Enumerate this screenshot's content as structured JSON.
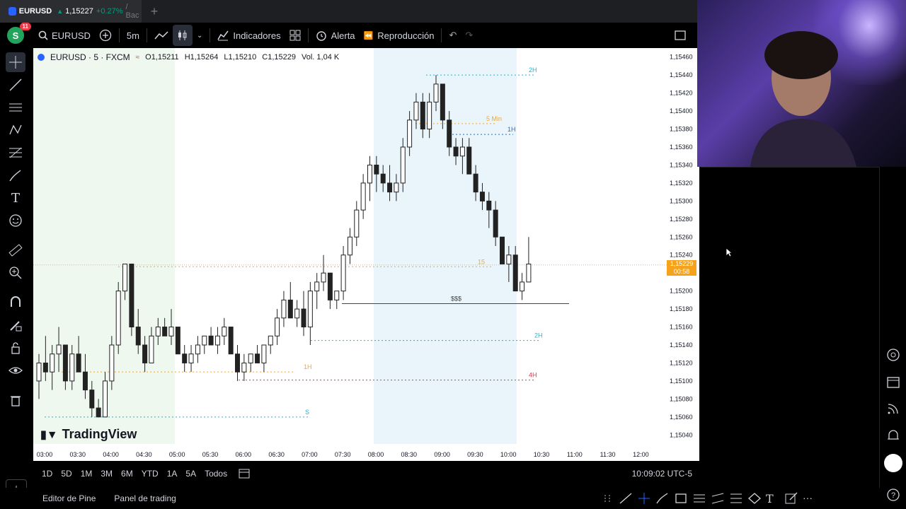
{
  "browser_tab": {
    "symbol": "EURUSD",
    "price": "1,15227",
    "change": "+0.27%",
    "suffix": "/ Bac"
  },
  "toolbar": {
    "avatar_letter": "S",
    "notifications": "11",
    "symbol": "EURUSD",
    "interval": "5m",
    "indicators_label": "Indicadores",
    "alert_label": "Alerta",
    "replay_label": "Reproducción"
  },
  "legend": {
    "title": "EURUSD · 5 · FXCM",
    "open": "O1,15211",
    "high": "H1,15264",
    "low": "L1,15210",
    "close": "C1,15229",
    "volume": "Vol. 1,04 K"
  },
  "price_tag": {
    "price": "1,15229",
    "countdown": "00:58"
  },
  "brand": "TradingView",
  "annotations": {
    "h2_top": "2H",
    "min5": "5 Min",
    "h1_top": "1H",
    "min15": "15",
    "sss": "$$$",
    "h2_mid": "2H",
    "h1_left": "1H",
    "h4": "4H",
    "s": "S"
  },
  "chart_data": {
    "type": "candlestick",
    "symbol": "EURUSD",
    "interval": "5",
    "exchange": "FXCM",
    "y_axis_ticks": [
      "1,15460",
      "1,15440",
      "1,15420",
      "1,15400",
      "1,15380",
      "1,15360",
      "1,15340",
      "1,15320",
      "1,15300",
      "1,15280",
      "1,15260",
      "1,15240",
      "1,15220",
      "1,15200",
      "1,15180",
      "1,15160",
      "1,15140",
      "1,15120",
      "1,15100",
      "1,15080",
      "1,15060",
      "1,15040"
    ],
    "x_axis_ticks": [
      "03:00",
      "03:30",
      "04:00",
      "04:30",
      "05:00",
      "05:30",
      "06:00",
      "06:30",
      "07:00",
      "07:30",
      "08:00",
      "08:30",
      "09:00",
      "09:30",
      "10:00",
      "10:30",
      "11:00",
      "11:30",
      "12:00"
    ],
    "ylim": [
      1.1503,
      1.1547
    ],
    "start_time": "02:55",
    "candles": [
      [
        1.151,
        1.1513,
        1.1508,
        1.1512
      ],
      [
        1.1512,
        1.1515,
        1.151,
        1.1511
      ],
      [
        1.1511,
        1.1514,
        1.1509,
        1.1513
      ],
      [
        1.1513,
        1.1516,
        1.1511,
        1.1514
      ],
      [
        1.1514,
        1.1514,
        1.1509,
        1.151
      ],
      [
        1.151,
        1.1514,
        1.1509,
        1.1513
      ],
      [
        1.1513,
        1.1515,
        1.1511,
        1.1511
      ],
      [
        1.1511,
        1.1513,
        1.1508,
        1.1509
      ],
      [
        1.1509,
        1.151,
        1.1506,
        1.1507
      ],
      [
        1.1507,
        1.1508,
        1.1506,
        1.1506
      ],
      [
        1.1506,
        1.1511,
        1.1506,
        1.151
      ],
      [
        1.151,
        1.1515,
        1.1509,
        1.1514
      ],
      [
        1.1514,
        1.1521,
        1.1513,
        1.152
      ],
      [
        1.152,
        1.1523,
        1.1519,
        1.1523
      ],
      [
        1.1523,
        1.1523,
        1.1515,
        1.1516
      ],
      [
        1.1516,
        1.1518,
        1.1513,
        1.1514
      ],
      [
        1.1514,
        1.1515,
        1.1511,
        1.1512
      ],
      [
        1.1512,
        1.1516,
        1.1512,
        1.1515
      ],
      [
        1.1515,
        1.1517,
        1.1514,
        1.1516
      ],
      [
        1.1516,
        1.1517,
        1.1515,
        1.1515
      ],
      [
        1.1515,
        1.1518,
        1.1514,
        1.1516
      ],
      [
        1.1516,
        1.1516,
        1.1513,
        1.1513
      ],
      [
        1.1513,
        1.1514,
        1.1511,
        1.1512
      ],
      [
        1.1512,
        1.1514,
        1.1511,
        1.1513
      ],
      [
        1.1513,
        1.1515,
        1.1512,
        1.1514
      ],
      [
        1.1514,
        1.1515,
        1.1513,
        1.1515
      ],
      [
        1.1515,
        1.1516,
        1.1514,
        1.1514
      ],
      [
        1.1514,
        1.1516,
        1.1513,
        1.1515
      ],
      [
        1.1515,
        1.1517,
        1.1514,
        1.1516
      ],
      [
        1.1516,
        1.1516,
        1.1513,
        1.1513
      ],
      [
        1.1513,
        1.1514,
        1.151,
        1.1511
      ],
      [
        1.1511,
        1.1513,
        1.151,
        1.1512
      ],
      [
        1.1512,
        1.1513,
        1.1511,
        1.1513
      ],
      [
        1.1513,
        1.1514,
        1.1512,
        1.1512
      ],
      [
        1.1512,
        1.1514,
        1.1511,
        1.1514
      ],
      [
        1.1514,
        1.1515,
        1.1513,
        1.1515
      ],
      [
        1.1515,
        1.1518,
        1.1514,
        1.1517
      ],
      [
        1.1517,
        1.152,
        1.1516,
        1.1519
      ],
      [
        1.1519,
        1.1521,
        1.1517,
        1.1517
      ],
      [
        1.1517,
        1.1519,
        1.1516,
        1.1518
      ],
      [
        1.1518,
        1.152,
        1.1515,
        1.1516
      ],
      [
        1.1516,
        1.1521,
        1.1514,
        1.152
      ],
      [
        1.152,
        1.1522,
        1.1518,
        1.1521
      ],
      [
        1.1521,
        1.1524,
        1.152,
        1.1522
      ],
      [
        1.1522,
        1.1522,
        1.1518,
        1.1519
      ],
      [
        1.1519,
        1.152,
        1.1518,
        1.152
      ],
      [
        1.152,
        1.1525,
        1.1519,
        1.1524
      ],
      [
        1.1524,
        1.1527,
        1.1523,
        1.1526
      ],
      [
        1.1526,
        1.153,
        1.1525,
        1.1529
      ],
      [
        1.1529,
        1.1533,
        1.1528,
        1.1532
      ],
      [
        1.1532,
        1.1535,
        1.153,
        1.1534
      ],
      [
        1.1534,
        1.1535,
        1.1531,
        1.1533
      ],
      [
        1.1533,
        1.1534,
        1.1531,
        1.1532
      ],
      [
        1.1532,
        1.1534,
        1.153,
        1.1531
      ],
      [
        1.1531,
        1.1533,
        1.153,
        1.1532
      ],
      [
        1.1532,
        1.1537,
        1.1531,
        1.1536
      ],
      [
        1.1536,
        1.154,
        1.1535,
        1.1539
      ],
      [
        1.1539,
        1.1542,
        1.1538,
        1.1541
      ],
      [
        1.1541,
        1.1542,
        1.1537,
        1.1538
      ],
      [
        1.1538,
        1.1542,
        1.1537,
        1.1541
      ],
      [
        1.1541,
        1.1544,
        1.154,
        1.1543
      ],
      [
        1.1543,
        1.1543,
        1.1538,
        1.1539
      ],
      [
        1.1539,
        1.154,
        1.1535,
        1.1536
      ],
      [
        1.1536,
        1.1537,
        1.1534,
        1.1535
      ],
      [
        1.1535,
        1.1537,
        1.1533,
        1.1536
      ],
      [
        1.1536,
        1.1537,
        1.1533,
        1.1533
      ],
      [
        1.1533,
        1.1534,
        1.153,
        1.1531
      ],
      [
        1.1531,
        1.1532,
        1.1529,
        1.153
      ],
      [
        1.153,
        1.1531,
        1.1527,
        1.1529
      ],
      [
        1.1529,
        1.153,
        1.1525,
        1.1526
      ],
      [
        1.1526,
        1.1526,
        1.1523,
        1.1523
      ],
      [
        1.1523,
        1.1525,
        1.1521,
        1.1524
      ],
      [
        1.1524,
        1.1525,
        1.152,
        1.152
      ],
      [
        1.152,
        1.1522,
        1.1519,
        1.1521
      ],
      [
        1.1521,
        1.1526,
        1.1521,
        1.1523
      ]
    ]
  },
  "range_buttons": [
    "1D",
    "5D",
    "1M",
    "3M",
    "6M",
    "YTD",
    "1A",
    "5A",
    "Todos"
  ],
  "clock": "10:09:02 UTC-5",
  "footer": {
    "pine_editor": "Editor de Pine",
    "trading_panel": "Panel de trading"
  }
}
